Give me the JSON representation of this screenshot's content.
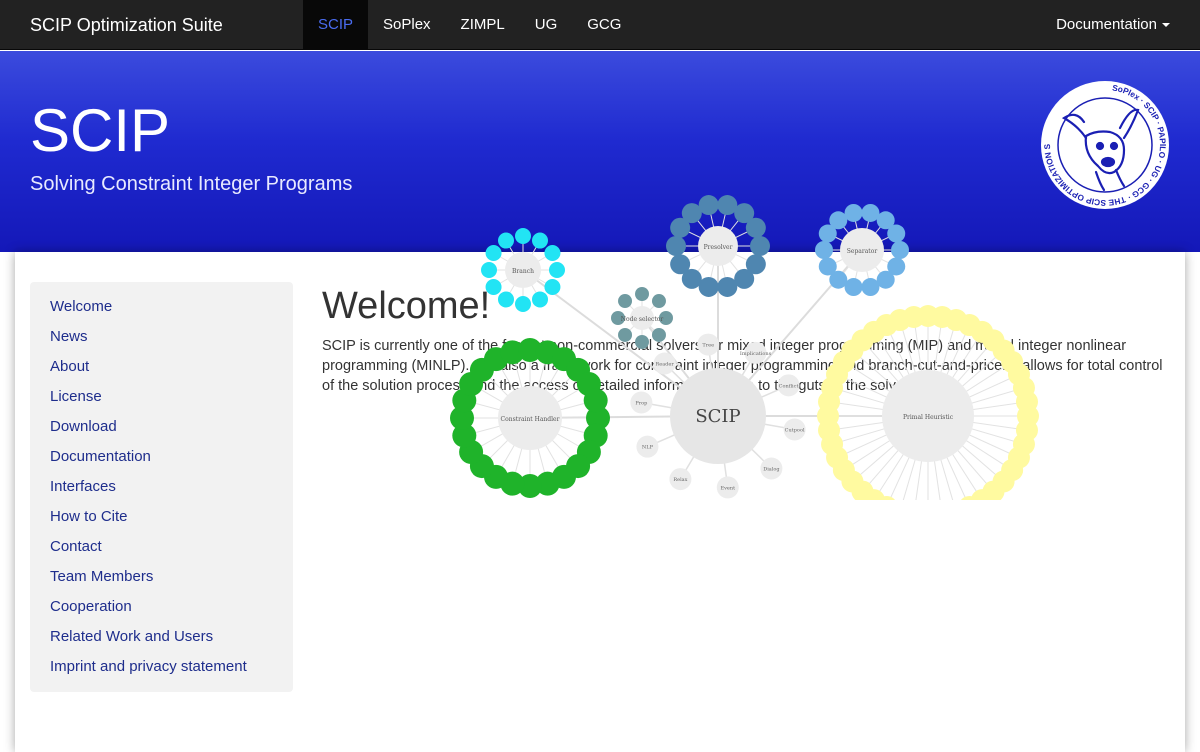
{
  "navbar": {
    "brand": "SCIP Optimization Suite",
    "tabs": [
      {
        "label": "SCIP",
        "active": true
      },
      {
        "label": "SoPlex",
        "active": false
      },
      {
        "label": "ZIMPL",
        "active": false
      },
      {
        "label": "UG",
        "active": false
      },
      {
        "label": "GCG",
        "active": false
      }
    ],
    "documentation_label": "Documentation"
  },
  "hero": {
    "title": "SCIP",
    "subtitle": "Solving Constraint Integer Programs",
    "logo": {
      "ring_text": "SoPlex · SCIP · PAPILO · UG · GCG · THE SCIP OPTIMIZATION SUITE · ZIMPL",
      "icon": "kangaroo-logo"
    }
  },
  "sidebar": {
    "items": [
      {
        "label": "Welcome"
      },
      {
        "label": "News"
      },
      {
        "label": "About"
      },
      {
        "label": "License"
      },
      {
        "label": "Download"
      },
      {
        "label": "Documentation"
      },
      {
        "label": "Interfaces"
      },
      {
        "label": "How to Cite"
      },
      {
        "label": "Contact"
      },
      {
        "label": "Team Members"
      },
      {
        "label": "Cooperation"
      },
      {
        "label": "Related Work and Users"
      },
      {
        "label": "Imprint and privacy statement"
      }
    ]
  },
  "main": {
    "heading": "Welcome!",
    "intro": "SCIP is currently one of the fastest non-commercial solvers for mixed integer programming (MIP) and mixed integer nonlinear programming (MINLP). It is also a framework for constraint integer programming and branch-cut-and-price. It allows for total control of the solution process and the access of detailed information down to the guts of the solver."
  },
  "figure": {
    "center_label": "SCIP",
    "clusters": [
      {
        "label": "Branch",
        "color": "#22e4f4"
      },
      {
        "label": "Presolver",
        "color": "#4f86b0"
      },
      {
        "label": "Separator",
        "color": "#6fb2e6"
      },
      {
        "label": "Node selector",
        "color": "#6f9aa0"
      },
      {
        "label": "Constraint Handler",
        "color": "#1fb32a"
      },
      {
        "label": "Primal Heuristic",
        "color": "#fffaa0"
      }
    ],
    "satellites": [
      "Tree",
      "Implications",
      "Conflict",
      "Cutpool",
      "Dialog",
      "Event",
      "Relax",
      "NLP",
      "Prop",
      "Reader"
    ]
  }
}
